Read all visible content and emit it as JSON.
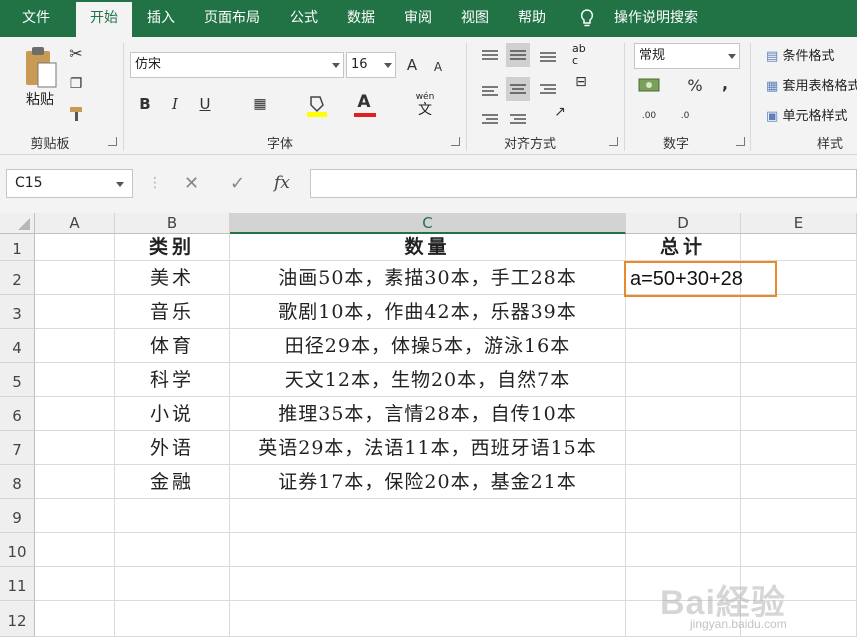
{
  "tabs": [
    "文件",
    "开始",
    "插入",
    "页面布局",
    "公式",
    "数据",
    "审阅",
    "视图",
    "帮助",
    "操作说明搜索"
  ],
  "ribbon": {
    "clipboard": {
      "paste_label": "粘贴",
      "group_label": "剪贴板"
    },
    "font": {
      "font_name": "仿宋",
      "font_size": "16",
      "bold": "B",
      "italic": "I",
      "underline": "U",
      "grow": "A",
      "shrink": "A",
      "color_a": "A",
      "wen": "wén",
      "wen_char": "文",
      "group_label": "字体"
    },
    "alignment": {
      "ab": "ab",
      "c": "c",
      "group_label": "对齐方式"
    },
    "number": {
      "format": "常规",
      "percent": "%",
      "comma": ",",
      "dec_inc": ".00",
      "dec_dec": ".0",
      "group_label": "数字"
    },
    "styles": {
      "cond": "条件格式",
      "table": "套用表格格式",
      "cell": "单元格样式",
      "group_label": "样式"
    }
  },
  "formula_bar": {
    "name_box": "C15",
    "cancel": "✕",
    "enter": "✓",
    "fx": "fx",
    "formula": ""
  },
  "columns": [
    "A",
    "B",
    "C",
    "D",
    "E"
  ],
  "rows": [
    "1",
    "2",
    "3",
    "4",
    "5",
    "6",
    "7",
    "8",
    "9",
    "10",
    "11",
    "12"
  ],
  "table": {
    "header": {
      "b": "类别",
      "c": "数量",
      "d": "总计"
    },
    "body": [
      {
        "b": "美术",
        "c": "油画50本，素描30本，手工28本"
      },
      {
        "b": "音乐",
        "c": "歌剧10本，作曲42本，乐器39本"
      },
      {
        "b": "体育",
        "c": "田径29本，体操5本，游泳16本"
      },
      {
        "b": "科学",
        "c": "天文12本，生物20本，自然7本"
      },
      {
        "b": "小说",
        "c": "推理35本，言情28本，自传10本"
      },
      {
        "b": "外语",
        "c": "英语29本，法语11本，西班牙语15本"
      },
      {
        "b": "金融",
        "c": "证券17本，保险20本，基金21本"
      }
    ],
    "d2": "a=50+30+28"
  },
  "watermark": {
    "main": "Bai経验",
    "sub": "jingyan.baidu.com"
  },
  "colors": {
    "accent": "#217346",
    "selection": "#e8892b"
  }
}
